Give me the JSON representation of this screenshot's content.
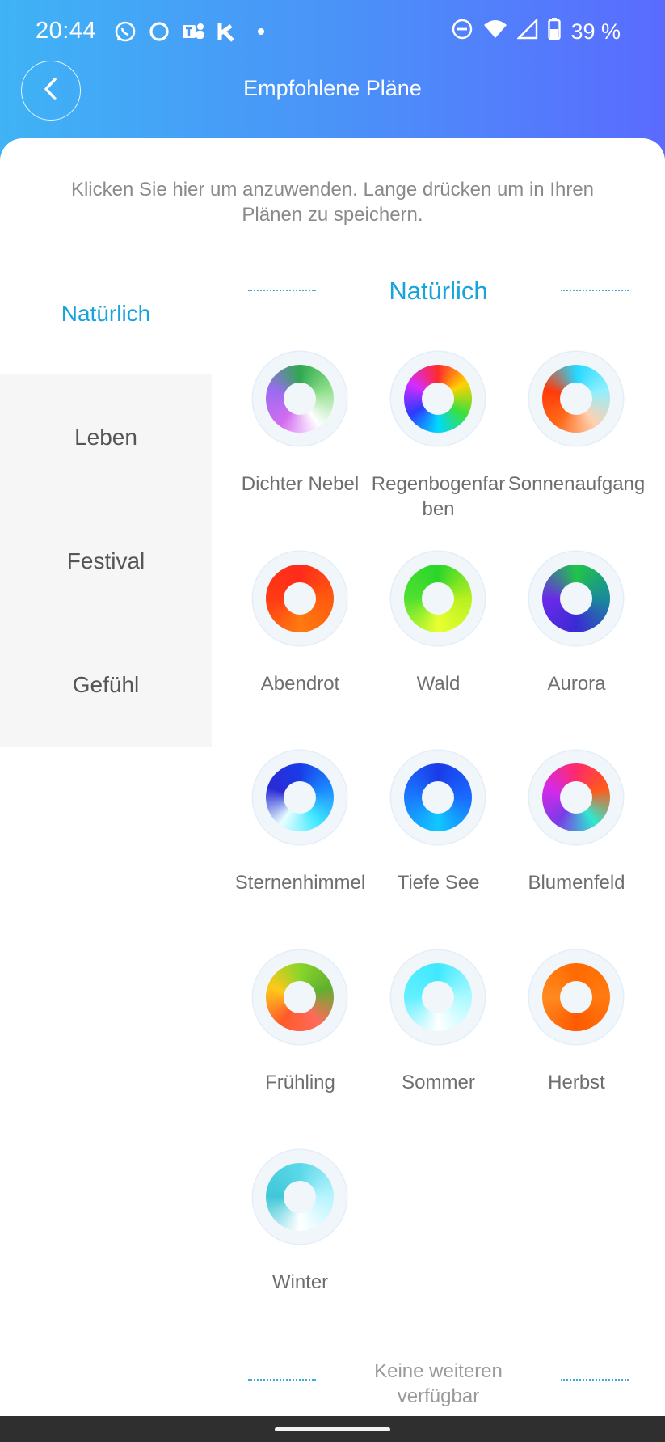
{
  "status": {
    "time": "20:44",
    "battery": "39 %",
    "left_icons": [
      "whatsapp-icon",
      "circle-app-icon",
      "teams-icon",
      "k-app-icon",
      "dot-icon"
    ],
    "right_icons": [
      "dnd-icon",
      "wifi-icon",
      "signal-icon",
      "battery-icon"
    ]
  },
  "header": {
    "title": "Empfohlene Pläne"
  },
  "hint": "Klicken Sie hier um anzuwenden. Lange drücken um in Ihren Plänen zu speichern.",
  "sidebar": {
    "items": [
      {
        "label": "Natürlich",
        "active": true
      },
      {
        "label": "Leben",
        "active": false
      },
      {
        "label": "Festival",
        "active": false
      },
      {
        "label": "Gefühl",
        "active": false
      }
    ]
  },
  "section": {
    "title": "Natürlich"
  },
  "plans": [
    {
      "label": "Dichter Nebel",
      "colors": [
        "#2fa84f",
        "#8fe08a",
        "#ffffff",
        "#d26cf0",
        "#9a6cf0",
        "#2fa84f"
      ]
    },
    {
      "label": "Regenbogenfarben",
      "colors": [
        "#ff2b2b",
        "#ffd200",
        "#3be03b",
        "#00d9ff",
        "#2b3bff",
        "#d52bff",
        "#ff2b2b"
      ]
    },
    {
      "label": "Sonnenaufgang",
      "colors": [
        "#25d8ff",
        "#8ff0ff",
        "#ffd0b0",
        "#ff6a1a",
        "#ff3a0a",
        "#25d8ff"
      ]
    },
    {
      "label": "Abendrot",
      "colors": [
        "#ff2a1a",
        "#ff5a10",
        "#ff7a10",
        "#ff3a14",
        "#ff2a1a"
      ]
    },
    {
      "label": "Wald",
      "colors": [
        "#2ad52a",
        "#b8f020",
        "#e8ff30",
        "#50e030",
        "#2ad52a"
      ]
    },
    {
      "label": "Aurora",
      "colors": [
        "#20c44a",
        "#1a8a9a",
        "#3b2ad5",
        "#6a2ae8",
        "#20c44a"
      ]
    },
    {
      "label": "Sternenhimmel",
      "colors": [
        "#1a3be8",
        "#1a8aff",
        "#40e8ff",
        "#e8ffff",
        "#2a2ad5",
        "#1a3be8"
      ]
    },
    {
      "label": "Tiefe See",
      "colors": [
        "#1a3be8",
        "#1a6aff",
        "#10c8ff",
        "#1a7aff",
        "#1a3be8"
      ]
    },
    {
      "label": "Blumenfeld",
      "colors": [
        "#ff2a6a",
        "#ff5a1a",
        "#30e8d0",
        "#7a3be8",
        "#d52ae8",
        "#ff2a6a"
      ]
    },
    {
      "label": "Frühling",
      "colors": [
        "#8ad52a",
        "#60b030",
        "#ff6a5a",
        "#ff5a2a",
        "#ffc81a",
        "#8ad52a"
      ]
    },
    {
      "label": "Sommer",
      "colors": [
        "#40e8ff",
        "#aafaff",
        "#ffffff",
        "#60f0ff",
        "#40e8ff"
      ]
    },
    {
      "label": "Herbst",
      "colors": [
        "#ff6a00",
        "#ff7a10",
        "#ff5a00",
        "#ff8a20",
        "#ff6a00"
      ]
    },
    {
      "label": "Winter",
      "colors": [
        "#5ad8e8",
        "#b8f4ff",
        "#ffffff",
        "#40c8d8",
        "#5ad8e8"
      ]
    }
  ],
  "footer": {
    "end_text": "Keine weiteren verfügbar"
  },
  "colors": {
    "accent": "#17a3db",
    "header_start": "#3fb3f5",
    "header_end": "#5a6bff"
  }
}
